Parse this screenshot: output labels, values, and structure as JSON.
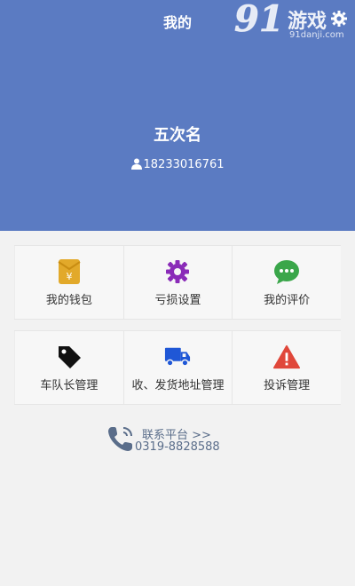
{
  "header": {
    "title": "我的",
    "watermark": {
      "number": "91",
      "text": "游戏",
      "domain": "91danji.com"
    },
    "user": {
      "name": "五次名",
      "phone": "18233016761"
    }
  },
  "menu": {
    "rows": [
      [
        {
          "label": "我的钱包",
          "icon": "wallet-icon",
          "color": "#e2a92a"
        },
        {
          "label": "亏损设置",
          "icon": "gear-icon",
          "color": "#8a2bb8"
        },
        {
          "label": "我的评价",
          "icon": "chat-icon",
          "color": "#3aa64a"
        }
      ],
      [
        {
          "label": "车队长管理",
          "icon": "tag-icon",
          "color": "#111111"
        },
        {
          "label": "收、发货地址管理",
          "icon": "truck-icon",
          "color": "#1f57d6"
        },
        {
          "label": "投诉管理",
          "icon": "warning-icon",
          "color": "#e0473a"
        }
      ]
    ]
  },
  "contact": {
    "label": "联系平台 >>",
    "number": "0319-8828588"
  },
  "colors": {
    "header_bg": "#5b7bc2",
    "page_bg": "#f2f2f2"
  }
}
